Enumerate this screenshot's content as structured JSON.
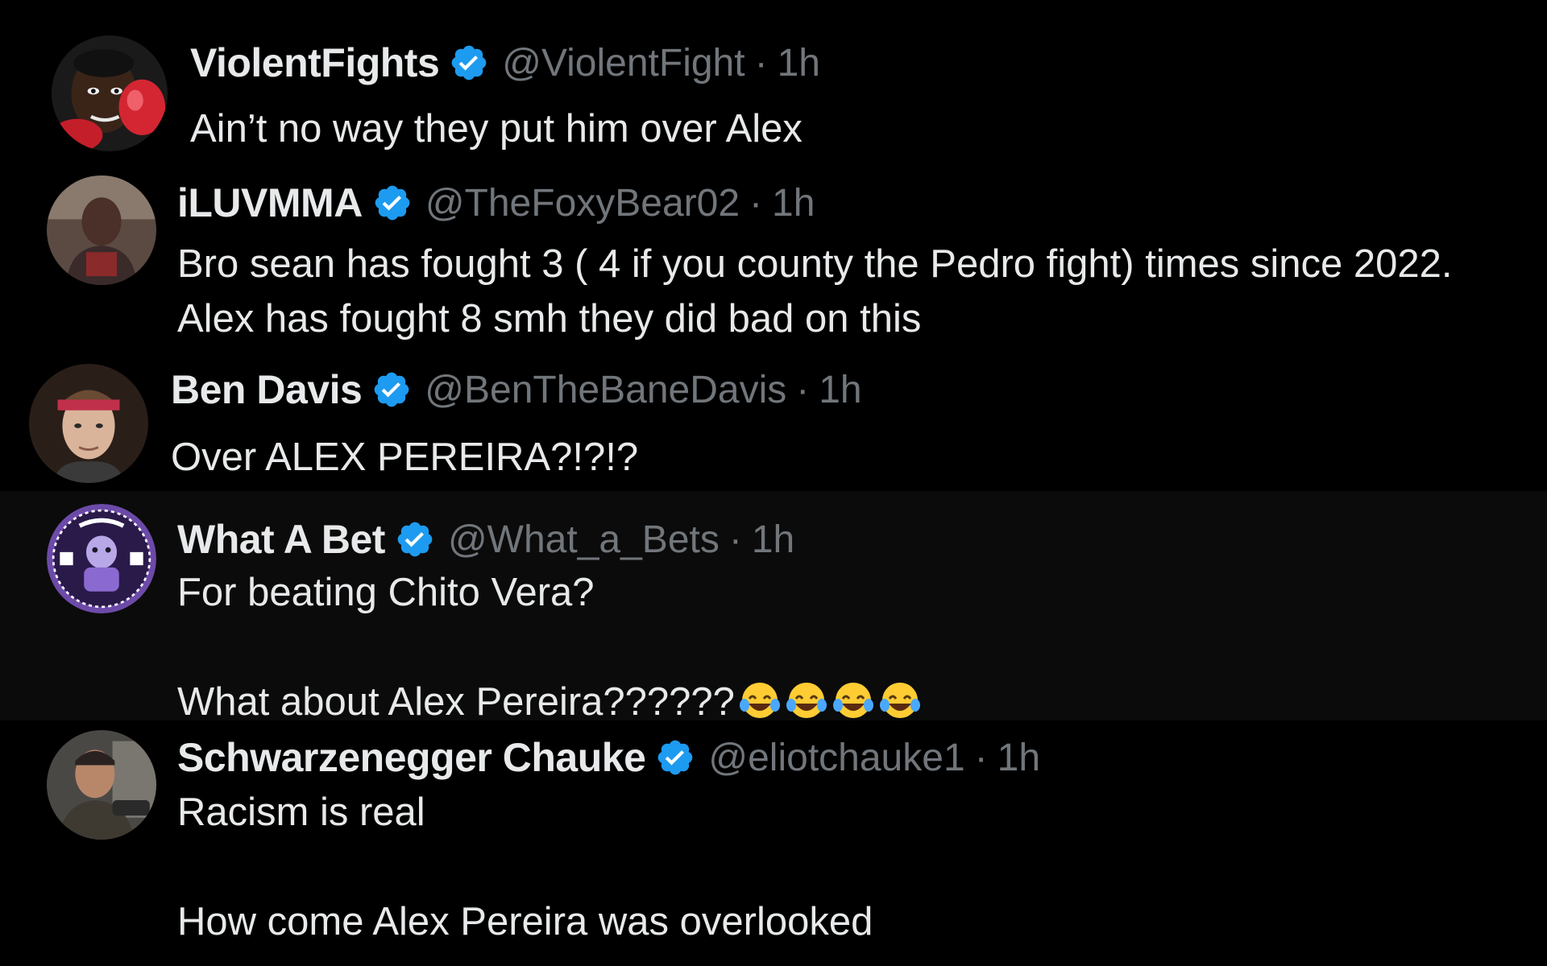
{
  "replies": [
    {
      "display_name": "ViolentFights",
      "handle": "@ViolentFight",
      "separator": "·",
      "time": "1h",
      "text_lines": [
        "Ain’t no way they put him over Alex"
      ],
      "avatar_icon": "boxer-avatar-icon"
    },
    {
      "display_name": "iLUVMMA",
      "handle": "@TheFoxyBear02",
      "separator": "·",
      "time": "1h",
      "text_lines": [
        "Bro sean has fought 3 ( 4 if you county the Pedro fight) times since 2022.",
        "Alex has fought 8 smh they did bad on this"
      ],
      "avatar_icon": "person-avatar-icon"
    },
    {
      "display_name": "Ben Davis",
      "handle": "@BenTheBaneDavis",
      "separator": "·",
      "time": "1h",
      "text_lines": [
        "Over ALEX PEREIRA?!?!?"
      ],
      "avatar_icon": "person-headband-avatar-icon"
    },
    {
      "display_name": "What A Bet",
      "handle": "@What_a_Bets",
      "separator": "·",
      "time": "1h",
      "text_lines": [
        "For beating Chito Vera?",
        "",
        "What about Alex Pereira??????"
      ],
      "emoji": "😂😂😂😂",
      "avatar_icon": "what-a-bets-logo-icon"
    },
    {
      "display_name": "Schwarzenegger Chauke",
      "handle": "@eliotchauke1",
      "separator": "·",
      "time": "1h",
      "text_lines": [
        "Racism is real",
        "",
        "How come Alex Pereira was overlooked"
      ],
      "avatar_icon": "person-avatar-icon"
    }
  ],
  "colors": {
    "background": "#000000",
    "alt_background": "#0b0b0b",
    "text": "#e7e9ea",
    "muted": "#71767b",
    "verified": "#1d9bf0"
  }
}
